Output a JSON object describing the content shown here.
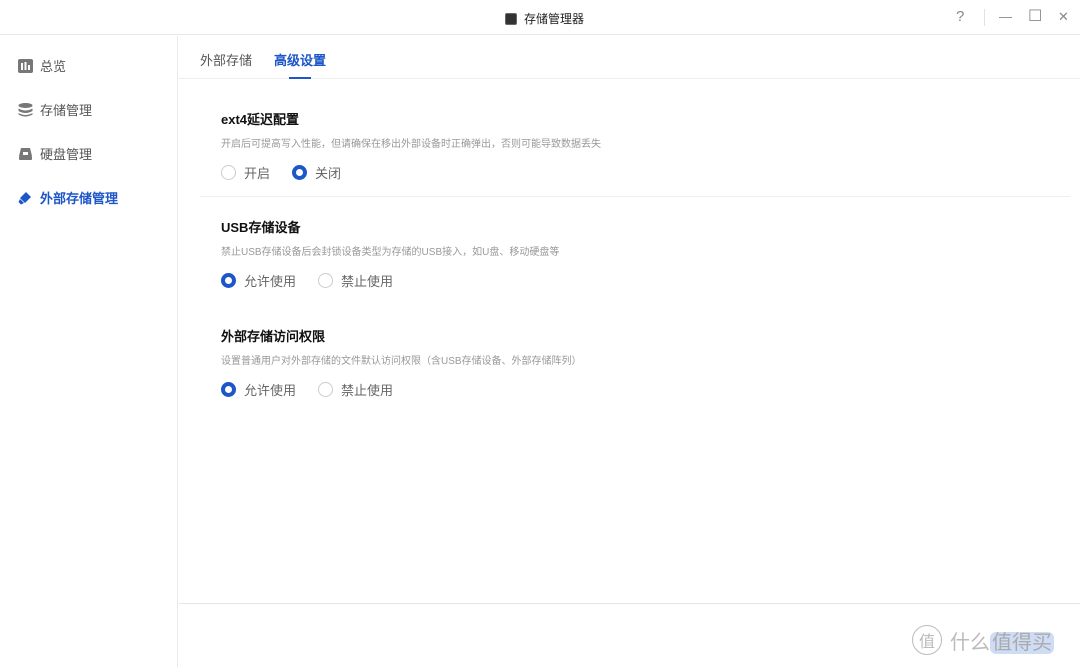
{
  "window": {
    "title": "存储管理器",
    "help": "?",
    "minimize": "—",
    "maximize": "☐",
    "close": "✕"
  },
  "sidebar": {
    "items": [
      {
        "label": "总览",
        "icon": "chart-icon"
      },
      {
        "label": "存储管理",
        "icon": "database-icon"
      },
      {
        "label": "硬盘管理",
        "icon": "disk-icon"
      },
      {
        "label": "外部存储管理",
        "icon": "usb-icon",
        "active": true
      }
    ]
  },
  "tabs": [
    {
      "label": "外部存储"
    },
    {
      "label": "高级设置",
      "active": true
    }
  ],
  "sections": [
    {
      "title": "ext4延迟配置",
      "desc": "开启后可提高写入性能，但请确保在移出外部设备时正确弹出，否则可能导致数据丢失",
      "options": [
        "开启",
        "关闭"
      ],
      "selected": 1
    },
    {
      "title": "USB存储设备",
      "desc": "禁止USB存储设备后会封锁设备类型为存储的USB接入，如U盘、移动硬盘等",
      "options": [
        "允许使用",
        "禁止使用"
      ],
      "selected": 0
    },
    {
      "title": "外部存储访问权限",
      "desc": "设置普通用户对外部存储的文件默认访问权限（含USB存储设备、外部存储阵列）",
      "options": [
        "允许使用",
        "禁止使用"
      ],
      "selected": 0
    }
  ],
  "watermark": {
    "badge": "值",
    "text1": "什么",
    "text2": "值得买"
  },
  "colors": {
    "accent": "#1d56c8"
  }
}
